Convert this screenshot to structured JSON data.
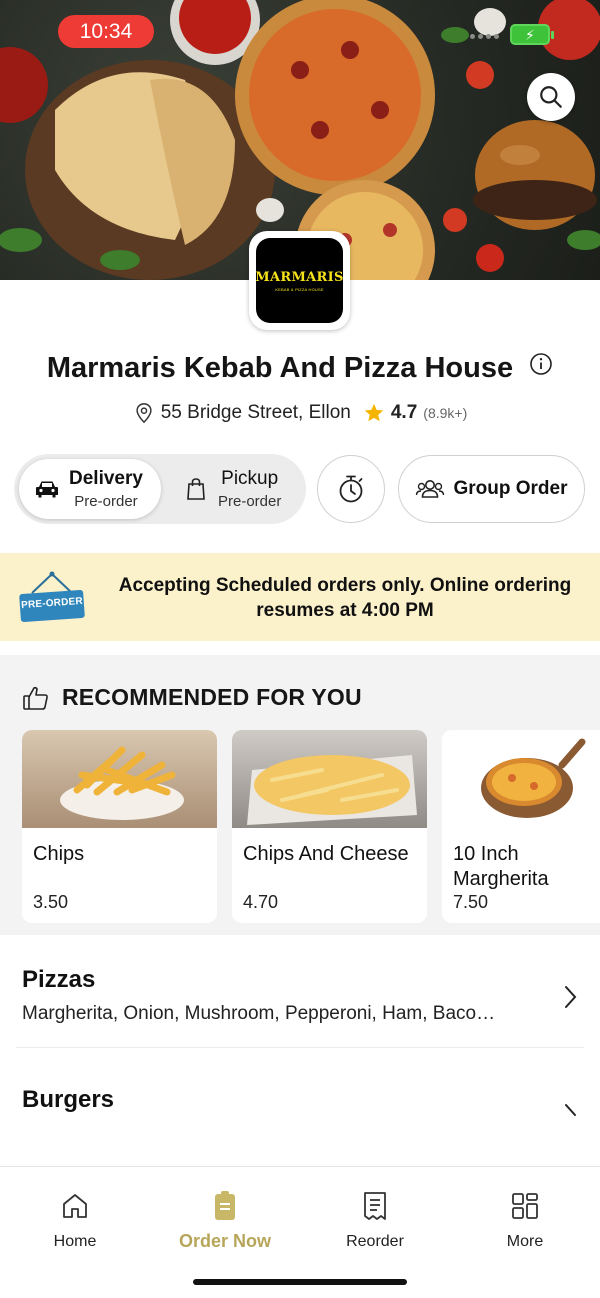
{
  "status_bar": {
    "time": "10:34"
  },
  "restaurant": {
    "logo_text": "MARMARIS",
    "logo_subtext": "KEBAB & PIZZA HOUSE",
    "name": "Marmaris Kebab And Pizza House",
    "address": "55 Bridge Street, Ellon",
    "rating": "4.7",
    "rating_count": "(8.9k+)"
  },
  "order_mode": {
    "options": [
      {
        "label": "Delivery",
        "sub": "Pre-order",
        "icon": "car-icon",
        "selected": true
      },
      {
        "label": "Pickup",
        "sub": "Pre-order",
        "icon": "bag-icon",
        "selected": false
      }
    ],
    "group_order_label": "Group Order"
  },
  "banner": {
    "badge_text": "PRE-ORDER",
    "message": "Accepting Scheduled orders only. Online ordering resumes at 4:00 PM"
  },
  "recommended": {
    "heading": "RECOMMENDED FOR YOU",
    "items": [
      {
        "name": "Chips",
        "price": "3.50"
      },
      {
        "name": "Chips And Cheese",
        "price": "4.70"
      },
      {
        "name": "10 Inch Margherita",
        "price": "7.50"
      }
    ]
  },
  "categories": [
    {
      "name": "Pizzas",
      "description": "Margherita, Onion, Mushroom, Pepperoni, Ham, Baco…"
    },
    {
      "name": "Burgers",
      "description": ""
    }
  ],
  "tab_bar": {
    "tabs": [
      {
        "label": "Home",
        "icon": "home-icon",
        "active": false
      },
      {
        "label": "Order Now",
        "icon": "order-now-icon",
        "active": true
      },
      {
        "label": "Reorder",
        "icon": "receipt-icon",
        "active": false
      },
      {
        "label": "More",
        "icon": "grid-icon",
        "active": false
      }
    ]
  },
  "colors": {
    "status_pill": "#ef3b36",
    "banner_bg": "#fbf1cb",
    "active_tab": "#b7a65a",
    "logo_text": "#f6e21a",
    "star": "#f5b400"
  }
}
